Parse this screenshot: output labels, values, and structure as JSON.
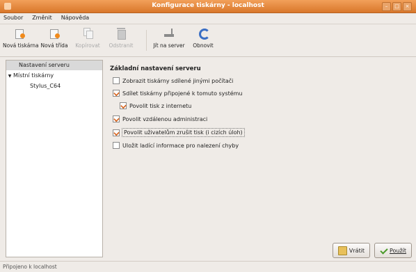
{
  "window": {
    "title": "Konfigurace tiskárny - localhost"
  },
  "menu": [
    "Soubor",
    "Změnit",
    "Nápověda"
  ],
  "toolbar": {
    "new_printer": "Nová tiskárna",
    "new_class": "Nová třída",
    "copy": "Kopírovat",
    "delete": "Odstranit",
    "goto_server": "Jít na server",
    "refresh": "Obnovit"
  },
  "sidebar": {
    "server_settings": "Nastavení serveru",
    "local_printers": "Místní tiskárny",
    "printer": "Stylus_C64"
  },
  "main": {
    "heading": "Základní nastavení serveru",
    "options": [
      {
        "label": "Zobrazit tiskárny sdílené jinými počítači",
        "checked": false
      },
      {
        "label": "Sdílet tiskárny připojené k tomuto systému",
        "checked": true
      },
      {
        "label": "Povolit tisk z internetu",
        "checked": true
      },
      {
        "label": "Povolit vzdálenou administraci",
        "checked": true
      },
      {
        "label": "Povolit uživatelům zrušit tisk (i cizích úloh)",
        "checked": true
      },
      {
        "label": "Uložit ladící informace pro nalezení chyby",
        "checked": false
      }
    ]
  },
  "buttons": {
    "revert": "Vrátit",
    "apply": "Použít"
  },
  "status": "Připojeno k localhost"
}
